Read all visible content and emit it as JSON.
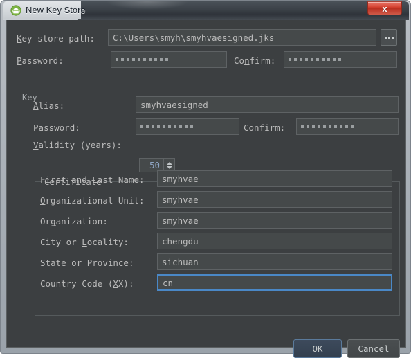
{
  "window": {
    "title": "New Key Store",
    "app_icon": "android-studio-icon",
    "close_label": "x"
  },
  "keystore": {
    "path_label_prefix": "",
    "path_label": "Key store path:",
    "path_label_mnemonic": "K",
    "path_label_rest": "ey store path:",
    "path_value": "C:\\Users\\smyh\\smyhvaesigned.jks",
    "browse_label": "...",
    "password_label_mnemonic": "P",
    "password_label_rest": "assword:",
    "password_dots": 10,
    "confirm_label_pre": "Co",
    "confirm_label_mnemonic": "n",
    "confirm_label_rest": "firm:",
    "confirm_dots": 10
  },
  "key_group": {
    "title": "Key",
    "alias_label_mnemonic": "A",
    "alias_label_rest": "lias:",
    "alias_value": "smyhvaesigned",
    "password_label_pre": "Pa",
    "password_label_mnemonic": "s",
    "password_label_rest": "sword:",
    "password_dots": 10,
    "confirm_label_mnemonic": "C",
    "confirm_label_rest": "onfirm:",
    "confirm_dots": 10,
    "validity_label_mnemonic": "V",
    "validity_label_rest": "alidity (years):",
    "validity_value": "50"
  },
  "certificate": {
    "title": "Certificate",
    "fields": [
      {
        "label_mnemonic": "F",
        "label_pre": "",
        "label_rest": "irst and Last Name:",
        "value": "smyhvae",
        "focused": false
      },
      {
        "label_mnemonic": "O",
        "label_pre": "",
        "label_rest": "rganizational Unit:",
        "value": "smyhvae",
        "focused": false
      },
      {
        "label_mnemonic": "g",
        "label_pre": "Or",
        "label_rest": "anization:",
        "value": "smyhvae",
        "focused": false
      },
      {
        "label_mnemonic": "L",
        "label_pre": "City or ",
        "label_rest": "ocality:",
        "value": "chengdu",
        "focused": false
      },
      {
        "label_mnemonic": "t",
        "label_pre": "S",
        "label_rest": "ate or Province:",
        "value": "sichuan",
        "focused": false
      },
      {
        "label_mnemonic": "X",
        "label_pre": "Country Code (",
        "label_rest": "X):",
        "value": "cn",
        "focused": true
      }
    ]
  },
  "buttons": {
    "ok": "OK",
    "cancel": "Cancel"
  },
  "colors": {
    "dialog_bg": "#3c3f41",
    "field_bg": "#45494a",
    "text": "#bbbbbb",
    "focus_border": "#4a88c7",
    "accent_ok": "#5a7a9b",
    "close_red": "#d4402f"
  }
}
